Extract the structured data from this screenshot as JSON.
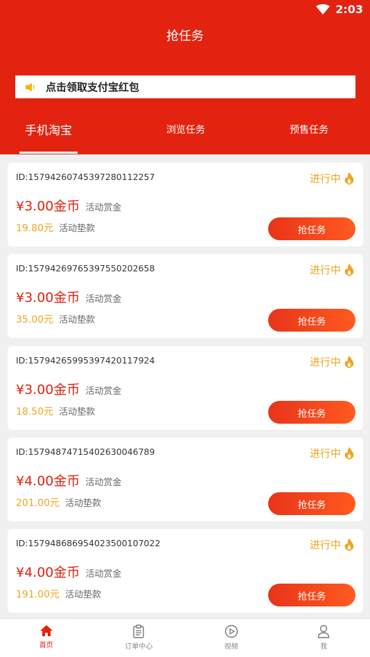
{
  "status_bar": {
    "time": "2:03"
  },
  "header": {
    "title": "抢任务"
  },
  "notice": {
    "text": "点击领取支付宝红包"
  },
  "tabs": [
    {
      "label": "手机淘宝",
      "active": true
    },
    {
      "label": "浏览任务",
      "active": false
    },
    {
      "label": "预售任务",
      "active": false
    }
  ],
  "tasks": [
    {
      "id": "ID:15794260745397280112257",
      "status": "进行中",
      "reward": "¥3.00金币",
      "reward_label": "活动赏金",
      "advance": "19.80元",
      "advance_label": "活动垫款",
      "button": "抢任务"
    },
    {
      "id": "ID:15794269765397550202658",
      "status": "进行中",
      "reward": "¥3.00金币",
      "reward_label": "活动赏金",
      "advance": "35.00元",
      "advance_label": "活动垫款",
      "button": "抢任务"
    },
    {
      "id": "ID:15794265995397420117924",
      "status": "进行中",
      "reward": "¥3.00金币",
      "reward_label": "活动赏金",
      "advance": "18.50元",
      "advance_label": "活动垫款",
      "button": "抢任务"
    },
    {
      "id": "ID:15794874715402630046789",
      "status": "进行中",
      "reward": "¥4.00金币",
      "reward_label": "活动赏金",
      "advance": "201.00元",
      "advance_label": "活动垫款",
      "button": "抢任务"
    },
    {
      "id": "ID:15794868695402350010702​2",
      "status": "进行中",
      "reward": "¥4.00金币",
      "reward_label": "活动赏金",
      "advance": "191.00元",
      "advance_label": "活动垫款",
      "button": "抢任务"
    }
  ],
  "bottom_nav": [
    {
      "label": "首页",
      "icon": "home-icon",
      "active": true
    },
    {
      "label": "订单中心",
      "icon": "clipboard-icon",
      "active": false
    },
    {
      "label": "视频",
      "icon": "play-icon",
      "active": false
    },
    {
      "label": "我",
      "icon": "user-icon",
      "active": false
    }
  ],
  "colors": {
    "brand_red": "#e3230f",
    "status_orange": "#f0a520"
  }
}
